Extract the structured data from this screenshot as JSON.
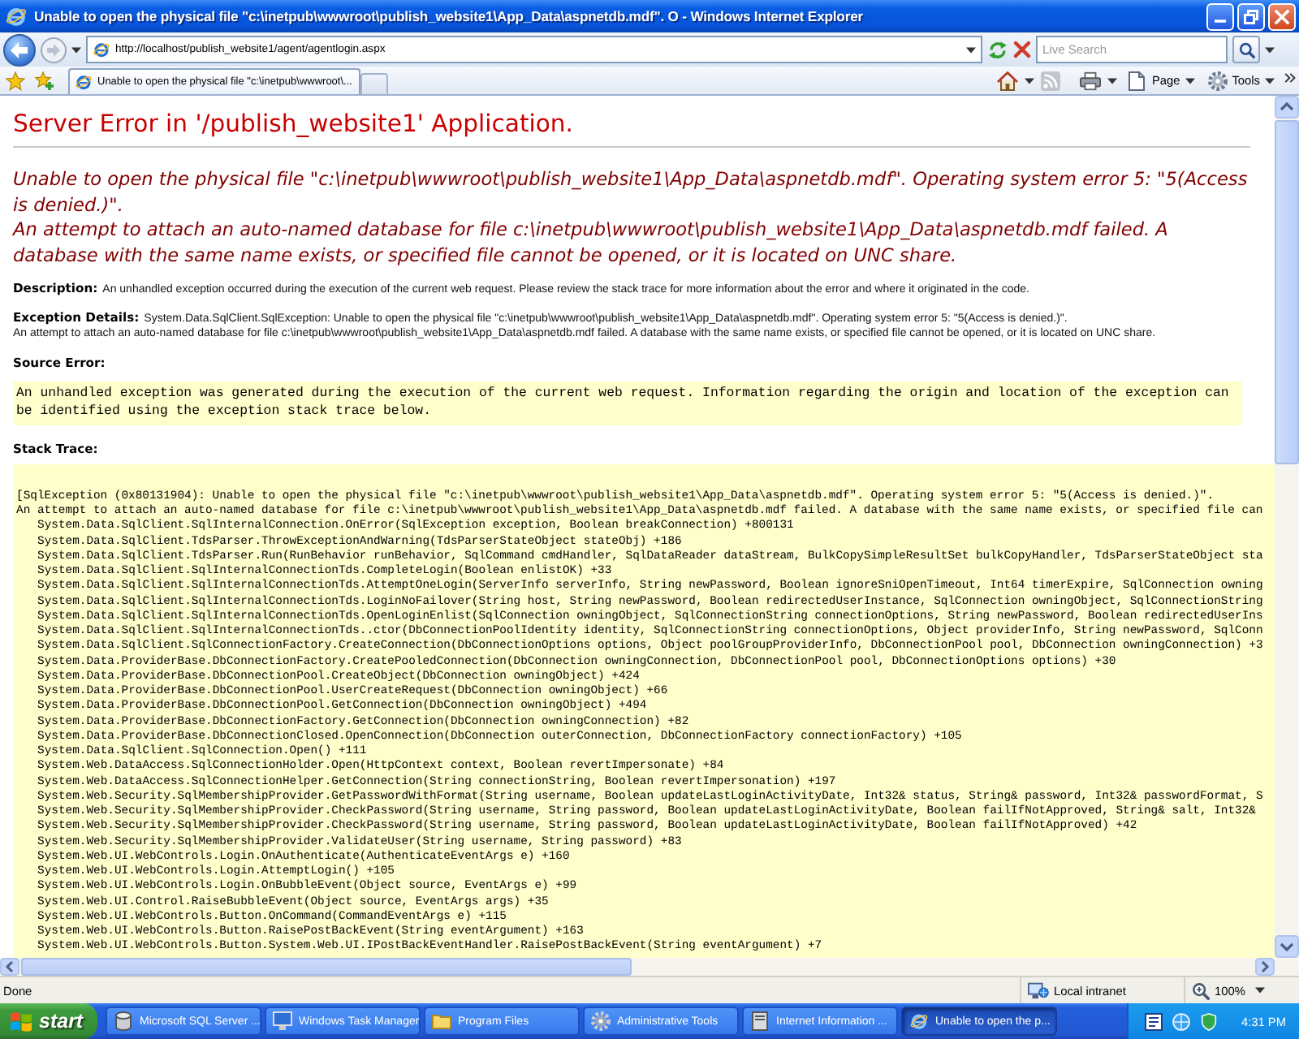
{
  "window": {
    "title": "Unable to open the physical file \"c:\\inetpub\\wwwroot\\publish_website1\\App_Data\\aspnetdb.mdf\". O - Windows Internet Explorer"
  },
  "address_bar": {
    "url": "http://localhost/publish_website1/agent/agentlogin.aspx"
  },
  "search": {
    "placeholder": "Live Search"
  },
  "tabs": [
    {
      "label": "Unable to open the physical file \"c:\\inetpub\\wwwroot\\...",
      "selected": true
    }
  ],
  "command_bar": {
    "page_menu": "Page",
    "tools_menu": "Tools"
  },
  "page": {
    "heading": "Server Error in '/publish_website1' Application.",
    "message": [
      "Unable to open the physical file \"c:\\inetpub\\wwwroot\\publish_website1\\App_Data\\aspnetdb.mdf\". Operating system error 5: \"5(Access is denied.)\".",
      "An attempt to attach an auto-named database for file c:\\inetpub\\wwwroot\\publish_website1\\App_Data\\aspnetdb.mdf failed. A database with the same name exists, or specified file cannot be opened, or it is located on UNC share."
    ],
    "description": {
      "label": "Description:",
      "text": "An unhandled exception occurred during the execution of the current web request. Please review the stack trace for more information about the error and where it originated in the code."
    },
    "exception_details": {
      "label": "Exception Details:",
      "lines": [
        "System.Data.SqlClient.SqlException: Unable to open the physical file \"c:\\inetpub\\wwwroot\\publish_website1\\App_Data\\aspnetdb.mdf\". Operating system error 5: \"5(Access is denied.)\".",
        "An attempt to attach an auto-named database for file c:\\inetpub\\wwwroot\\publish_website1\\App_Data\\aspnetdb.mdf failed. A database with the same name exists, or specified file cannot be opened, or it is located on UNC share."
      ]
    },
    "source_error": {
      "label": "Source Error:",
      "text": "An unhandled exception was generated during the execution of the current web request. Information regarding the origin and location of the exception can be identified using the exception stack trace below."
    },
    "stack_trace": {
      "label": "Stack Trace:",
      "exception": [
        "[SqlException (0x80131904): Unable to open the physical file \"c:\\inetpub\\wwwroot\\publish_website1\\App_Data\\aspnetdb.mdf\". Operating system error 5: \"5(Access is denied.)\".",
        "An attempt to attach an auto-named database for file c:\\inetpub\\wwwroot\\publish_website1\\App_Data\\aspnetdb.mdf failed. A database with the same name exists, or specified file can"
      ],
      "frames": [
        "System.Data.SqlClient.SqlInternalConnection.OnError(SqlException exception, Boolean breakConnection) +800131",
        "System.Data.SqlClient.TdsParser.ThrowExceptionAndWarning(TdsParserStateObject stateObj) +186",
        "System.Data.SqlClient.TdsParser.Run(RunBehavior runBehavior, SqlCommand cmdHandler, SqlDataReader dataStream, BulkCopySimpleResultSet bulkCopyHandler, TdsParserStateObject sta",
        "System.Data.SqlClient.SqlInternalConnectionTds.CompleteLogin(Boolean enlistOK) +33",
        "System.Data.SqlClient.SqlInternalConnectionTds.AttemptOneLogin(ServerInfo serverInfo, String newPassword, Boolean ignoreSniOpenTimeout, Int64 timerExpire, SqlConnection owning",
        "System.Data.SqlClient.SqlInternalConnectionTds.LoginNoFailover(String host, String newPassword, Boolean redirectedUserInstance, SqlConnection owningObject, SqlConnectionString",
        "System.Data.SqlClient.SqlInternalConnectionTds.OpenLoginEnlist(SqlConnection owningObject, SqlConnectionString connectionOptions, String newPassword, Boolean redirectedUserIns",
        "System.Data.SqlClient.SqlInternalConnectionTds..ctor(DbConnectionPoolIdentity identity, SqlConnectionString connectionOptions, Object providerInfo, String newPassword, SqlConn",
        "System.Data.SqlClient.SqlConnectionFactory.CreateConnection(DbConnectionOptions options, Object poolGroupProviderInfo, DbConnectionPool pool, DbConnection owningConnection) +3",
        "System.Data.ProviderBase.DbConnectionFactory.CreatePooledConnection(DbConnection owningConnection, DbConnectionPool pool, DbConnectionOptions options) +30",
        "System.Data.ProviderBase.DbConnectionPool.CreateObject(DbConnection owningObject) +424",
        "System.Data.ProviderBase.DbConnectionPool.UserCreateRequest(DbConnection owningObject) +66",
        "System.Data.ProviderBase.DbConnectionPool.GetConnection(DbConnection owningObject) +494",
        "System.Data.ProviderBase.DbConnectionFactory.GetConnection(DbConnection owningConnection) +82",
        "System.Data.ProviderBase.DbConnectionClosed.OpenConnection(DbConnection outerConnection, DbConnectionFactory connectionFactory) +105",
        "System.Data.SqlClient.SqlConnection.Open() +111",
        "System.Web.DataAccess.SqlConnectionHolder.Open(HttpContext context, Boolean revertImpersonate) +84",
        "System.Web.DataAccess.SqlConnectionHelper.GetConnection(String connectionString, Boolean revertImpersonation) +197",
        "System.Web.Security.SqlMembershipProvider.GetPasswordWithFormat(String username, Boolean updateLastLoginActivityDate, Int32& status, String& password, Int32& passwordFormat, S",
        "System.Web.Security.SqlMembershipProvider.CheckPassword(String username, String password, Boolean updateLastLoginActivityDate, Boolean failIfNotApproved, String& salt, Int32&",
        "System.Web.Security.SqlMembershipProvider.CheckPassword(String username, String password, Boolean updateLastLoginActivityDate, Boolean failIfNotApproved) +42",
        "System.Web.Security.SqlMembershipProvider.ValidateUser(String username, String password) +83",
        "System.Web.UI.WebControls.Login.OnAuthenticate(AuthenticateEventArgs e) +160",
        "System.Web.UI.WebControls.Login.AttemptLogin() +105",
        "System.Web.UI.WebControls.Login.OnBubbleEvent(Object source, EventArgs e) +99",
        "System.Web.UI.Control.RaiseBubbleEvent(Object source, EventArgs args) +35",
        "System.Web.UI.WebControls.Button.OnCommand(CommandEventArgs e) +115",
        "System.Web.UI.WebControls.Button.RaisePostBackEvent(String eventArgument) +163",
        "System.Web.UI.WebControls.Button.System.Web.UI.IPostBackEventHandler.RaisePostBackEvent(String eventArgument) +7"
      ]
    }
  },
  "status_bar": {
    "status": "Done",
    "zone": "Local intranet",
    "zoom": "100%"
  },
  "taskbar": {
    "start": "start",
    "buttons": [
      {
        "kind": "database",
        "label": "Microsoft SQL Server ...",
        "selected": false
      },
      {
        "kind": "monitor",
        "label": "Windows Task Manager",
        "selected": false
      },
      {
        "kind": "folder",
        "label": "Program Files",
        "selected": false
      },
      {
        "kind": "tools",
        "label": "Administrative Tools",
        "selected": false
      },
      {
        "kind": "server",
        "label": "Internet Information ...",
        "selected": false
      },
      {
        "kind": "browser",
        "label": "Unable to open the p...",
        "selected": true
      }
    ],
    "clock": "4:31 PM"
  }
}
